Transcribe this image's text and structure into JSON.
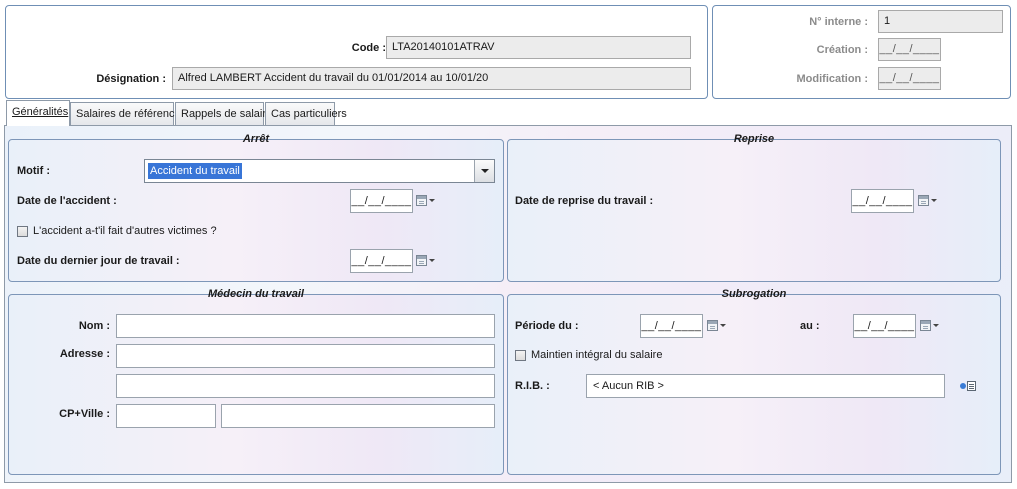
{
  "header": {
    "code_label": "Code :",
    "code_value": "LTA20140101ATRAV",
    "designation_label": "Désignation :",
    "designation_value": "Alfred LAMBERT Accident du travail du 01/01/2014 au 10/01/20",
    "internal_no_label": "N° interne :",
    "internal_no_value": "1",
    "creation_label": "Création :",
    "creation_value": "__/__/____",
    "modification_label": "Modification :",
    "modification_value": "__/__/____"
  },
  "tabs": [
    {
      "label": "Généralités",
      "active": true
    },
    {
      "label": "Salaires de référence",
      "active": false
    },
    {
      "label": "Rappels de salaire",
      "active": false
    },
    {
      "label": "Cas particuliers",
      "active": false
    }
  ],
  "arret": {
    "title": "Arrêt",
    "motif_label": "Motif :",
    "motif_value": "Accident du travail",
    "accident_date_label": "Date de l'accident :",
    "accident_date_value": "__/__/____",
    "other_victims_label": "L'accident a-t'il fait d'autres victimes ?",
    "other_victims_checked": false,
    "last_day_label": "Date du dernier jour de travail :",
    "last_day_value": "__/__/____"
  },
  "reprise": {
    "title": "Reprise",
    "return_date_label": "Date de reprise du travail :",
    "return_date_value": "__/__/____"
  },
  "medecin": {
    "title": "Médecin du travail",
    "nom_label": "Nom :",
    "nom_value": "",
    "adresse_label": "Adresse :",
    "adresse_value": "",
    "adresse2_value": "",
    "cp_ville_label": "CP+Ville :",
    "cp_value": "",
    "ville_value": ""
  },
  "subrogation": {
    "title": "Subrogation",
    "periode_label": "Période du :",
    "periode_from_value": "__/__/____",
    "au_label": "au :",
    "periode_to_value": "__/__/____",
    "maintien_label": "Maintien intégral du salaire",
    "maintien_checked": false,
    "rib_label": "R.I.B. :",
    "rib_value": "< Aucun RIB >"
  }
}
